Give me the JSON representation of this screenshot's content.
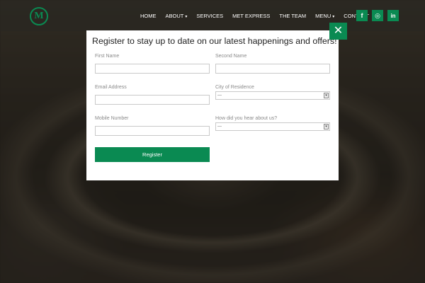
{
  "header": {
    "logo_letter": "M",
    "nav": [
      {
        "label": "HOME"
      },
      {
        "label": "ABOUT",
        "dropdown": true
      },
      {
        "label": "SERVICES"
      },
      {
        "label": "MET EXPRESS"
      },
      {
        "label": "THE TEAM"
      },
      {
        "label": "MENU",
        "dropdown": true
      },
      {
        "label": "CONTACT"
      }
    ],
    "caret": "▾",
    "social": [
      {
        "icon": "facebook-icon",
        "glyph": "f"
      },
      {
        "icon": "instagram-icon",
        "glyph": "◎"
      },
      {
        "icon": "linkedin-icon",
        "glyph": "in"
      }
    ]
  },
  "modal": {
    "title": "Register to stay up to date on our latest happenings and offers!",
    "close_glyph": "✕",
    "fields": {
      "first_name": {
        "label": "First Name",
        "value": ""
      },
      "second_name": {
        "label": "Second Name",
        "value": ""
      },
      "email": {
        "label": "Email Address",
        "value": ""
      },
      "city": {
        "label": "City of Residence",
        "selected": "---"
      },
      "mobile": {
        "label": "Mobile Number",
        "value": ""
      },
      "heard": {
        "label": "How did you hear about us?",
        "selected": "---"
      }
    },
    "register_label": "Register"
  },
  "colors": {
    "accent": "#0a8a52"
  }
}
